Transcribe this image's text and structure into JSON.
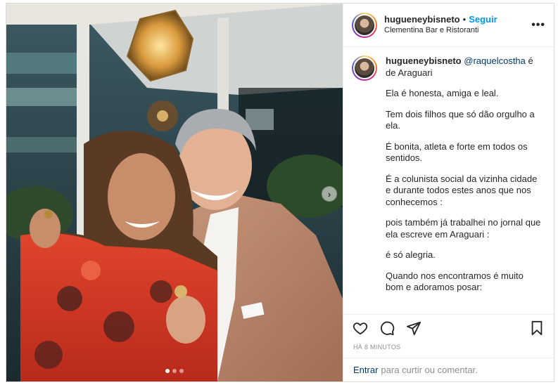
{
  "post": {
    "username": "hugueneybisneto",
    "separator": "•",
    "follow_label": "Seguir",
    "location": "Clementina Bar e Ristoranti",
    "more_label": "•••",
    "caption": {
      "username": "hugueneybisneto",
      "mention": "@raquelcostha",
      "intro_rest": " é de Araguari",
      "paragraphs": [
        "Ela é honesta, amiga e leal.",
        "Tem dois filhos que só dão orgulho a ela.",
        "É bonita, atleta e forte em todos os sentidos.",
        "É a colunista social da vizinha cidade e durante todos estes anos que nos conhecemos :",
        "pois também já trabalhei no jornal que ela escreve em Araguari :",
        "é só alegria.",
        "Quando nos encontramos é muito bom e adoramos posar:"
      ]
    },
    "timestamp": "HÁ 8 MINUTOS",
    "comment_login": "Entrar",
    "comment_rest": "para curtir ou comentar.",
    "carousel": {
      "slides": 3,
      "active_index": 0,
      "next_label": "›"
    }
  },
  "icons": {
    "like": "heart-icon",
    "comment": "comment-bubble-icon",
    "share": "paper-plane-icon",
    "save": "bookmark-icon"
  },
  "colors": {
    "follow": "#0095f6",
    "mention": "#00376b",
    "muted": "#8e8e8e"
  }
}
